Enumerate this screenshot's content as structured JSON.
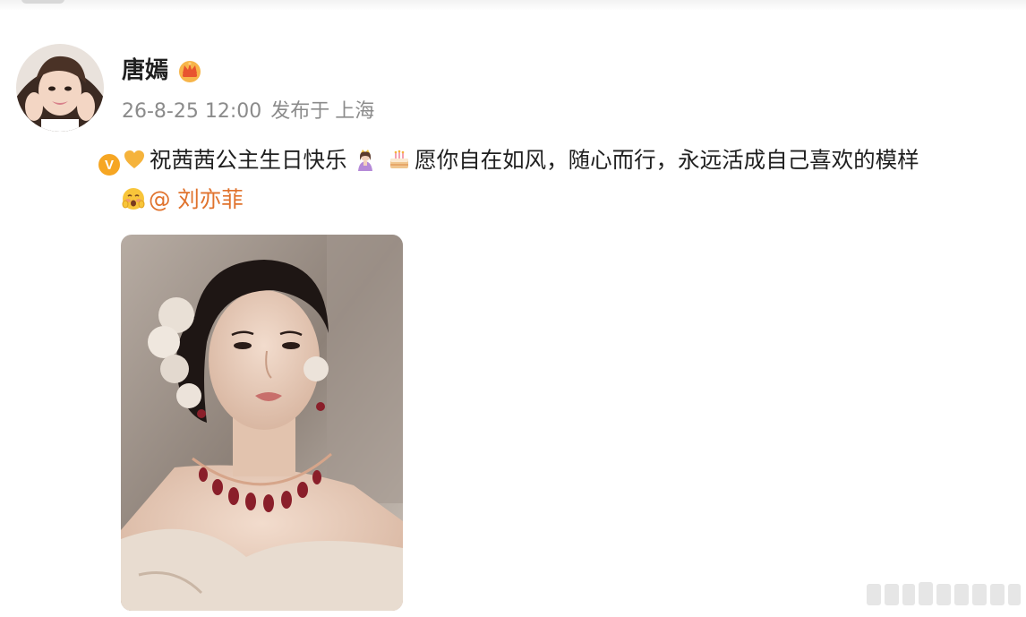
{
  "post": {
    "author": "唐嫣",
    "timestamp": "26-8-25 12:00",
    "published_at_prefix": "发布于",
    "location": "上海",
    "text_part1": "祝茜茜公主生日快乐",
    "text_part2": "愿你自在如风，随心而行，永远活成自己喜欢的模样",
    "mention": "@ 刘亦菲"
  },
  "icons": {
    "author_badge": "crown-icon",
    "verified": "verified-v-badge-icon",
    "emojis": [
      "yellow-heart-icon",
      "princess-icon",
      "birthday-cake-icon",
      "blushing-face-icon"
    ]
  },
  "verified_badge_letter": "V",
  "colors": {
    "mention": "#e0722c",
    "meta_text": "#8b8b8b",
    "badge": "#f6a623"
  }
}
